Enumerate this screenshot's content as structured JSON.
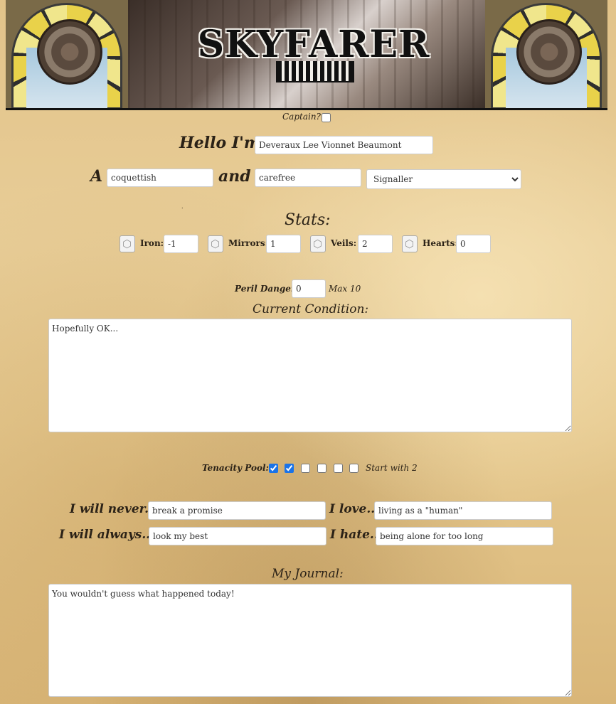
{
  "header": {
    "title": "SKYFARER"
  },
  "captain": {
    "label": "Captain?:",
    "checked": false
  },
  "intro": {
    "hello_label": "Hello I'm",
    "name": "Deveraux Lee Vionnet Beaumont",
    "a_label": "A",
    "trait1": "coquettish",
    "and_label": "and",
    "trait2": "carefree",
    "role_selected": "Signaller"
  },
  "stats": {
    "title": "Stats:",
    "items": [
      {
        "label": "Iron:",
        "value": "-1"
      },
      {
        "label": "Mirrors:",
        "value": "1"
      },
      {
        "label": "Veils:",
        "value": "2"
      },
      {
        "label": "Hearts:",
        "value": "0"
      }
    ]
  },
  "peril": {
    "label": "Peril Danger:",
    "value": "0",
    "max_label": "Max 10"
  },
  "condition": {
    "title": "Current Condition:",
    "text": "Hopefully OK..."
  },
  "tenacity": {
    "label": "Tenacity Pool:",
    "boxes": [
      true,
      true,
      false,
      false,
      false,
      false
    ],
    "note": "Start with 2"
  },
  "beliefs": {
    "never_label": "I will never...",
    "never_value": "break a promise",
    "love_label": "I love...",
    "love_value": "living as a \"human\"",
    "always_label": "I will always...",
    "always_value": "look my best",
    "hate_label": "I hate...",
    "hate_value": "being alone for too long"
  },
  "journal": {
    "title": "My Journal:",
    "text": "You wouldn't guess what happened today!"
  }
}
